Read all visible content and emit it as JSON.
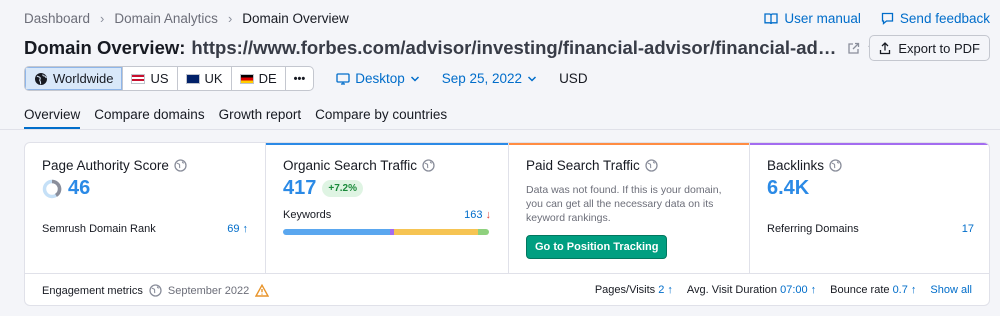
{
  "breadcrumb": [
    "Dashboard",
    "Domain Analytics",
    "Domain Overview"
  ],
  "toplinks": {
    "manual": "User manual",
    "feedback": "Send feedback"
  },
  "header": {
    "title": "Domain Overview:",
    "url": "https://www.forbes.com/advisor/investing/financial-advisor/financial-advisor/",
    "export_label": "Export to PDF"
  },
  "filters": {
    "regions": [
      "Worldwide",
      "US",
      "UK",
      "DE"
    ],
    "more": "•••",
    "device": "Desktop",
    "date": "Sep 25, 2022",
    "currency": "USD"
  },
  "tabs": [
    "Overview",
    "Compare domains",
    "Growth report",
    "Compare by countries"
  ],
  "cards": {
    "authority": {
      "title": "Page Authority Score",
      "value": "46",
      "sub_label": "Semrush Domain Rank",
      "sub_value": "69"
    },
    "organic": {
      "title": "Organic Search Traffic",
      "value": "417",
      "change": "+7.2%",
      "sub_label": "Keywords",
      "sub_value": "163"
    },
    "paid": {
      "title": "Paid Search Traffic",
      "message": "Data was not found. If this is your domain, you can get all the necessary data on its keyword rankings.",
      "button": "Go to Position Tracking"
    },
    "backlinks": {
      "title": "Backlinks",
      "value": "6.4K",
      "sub_label": "Referring Domains",
      "sub_value": "17"
    }
  },
  "engagement": {
    "label": "Engagement metrics",
    "month": "September 2022",
    "pages_label": "Pages/Visits",
    "pages_value": "2",
    "duration_label": "Avg. Visit Duration",
    "duration_value": "07:00",
    "bounce_label": "Bounce rate",
    "bounce_value": "0.7",
    "show_all": "Show all"
  },
  "colors": {
    "accent": "#006dca",
    "organic_top": "#2b8ae6",
    "paid_top": "#ff8c42",
    "backlinks_top": "#a36cf0",
    "button_green": "#009f81"
  }
}
